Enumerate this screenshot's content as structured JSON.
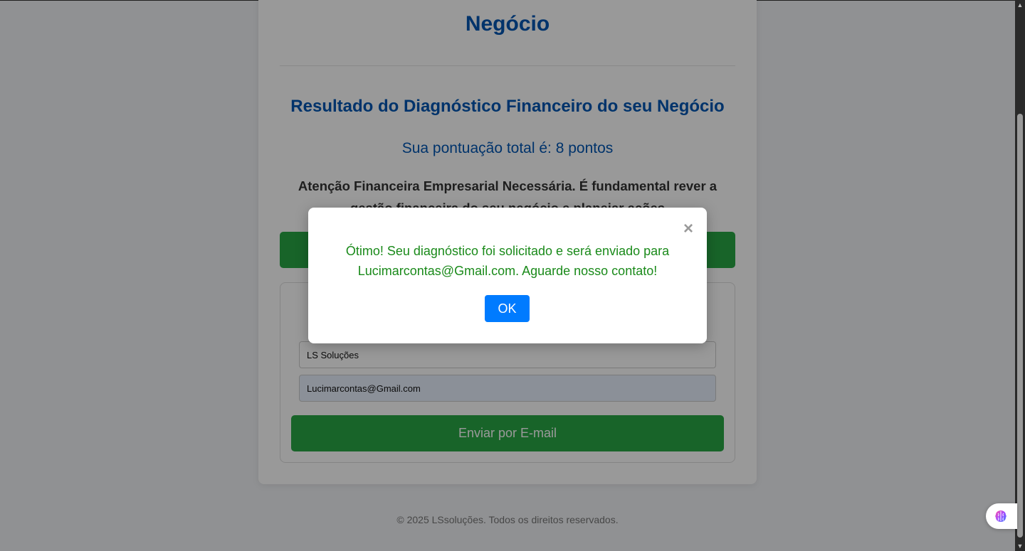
{
  "page": {
    "title": "Negócio",
    "result_title": "Resultado do Diagnóstico Financeiro do seu Negócio",
    "score_text": "Sua pontuação total é: 8 pontos",
    "message": "Atenção Financeira Empresarial Necessária. É fundamental rever a gestão financeira do seu negócio e planejar ações"
  },
  "email_form": {
    "company_value": "LS Soluções",
    "email_value": "Lucimarcontas@Gmail.com",
    "send_label": "Enviar por E-mail"
  },
  "footer": {
    "text": "© 2025 LSsoluções. Todos os direitos reservados."
  },
  "modal": {
    "close_symbol": "×",
    "message": "Ótimo! Seu diagnóstico foi solicitado e será enviado para Lucimarcontas@Gmail.com. Aguarde nosso contato!",
    "ok_label": "OK"
  },
  "scrollbar": {
    "up_arrow": "▲",
    "down_arrow": "▼"
  },
  "colors": {
    "primary_blue": "#0056b3",
    "success_green": "#28a745",
    "button_blue": "#007bff",
    "modal_text_green": "#1a8a1a"
  },
  "icons": {
    "extension": "brain-icon"
  }
}
